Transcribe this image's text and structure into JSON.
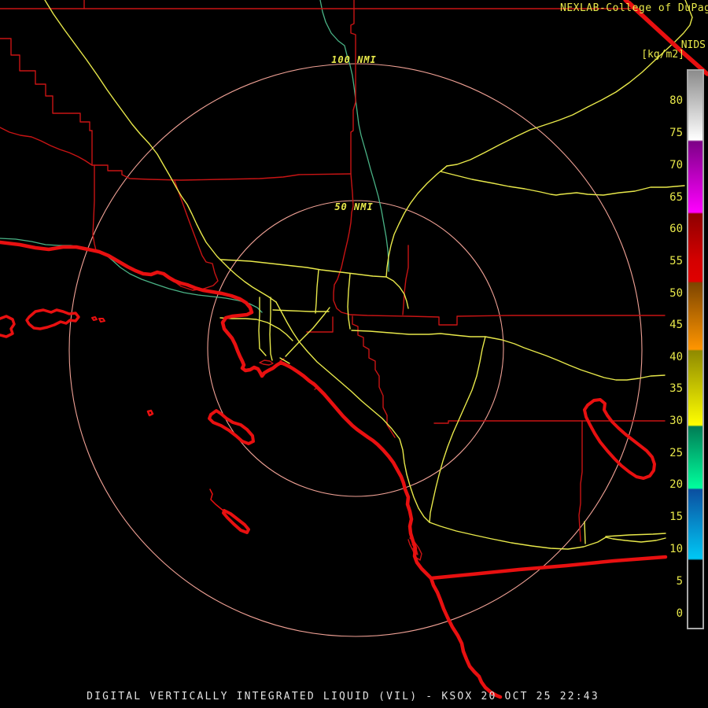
{
  "header": {
    "brand": "NEXLAB-College of DuPage",
    "flag_icon": "cod-flag-icon"
  },
  "colorbar": {
    "title": "NIDS",
    "unit": "[kg/m2]",
    "ticks": [
      "80",
      "75",
      "70",
      "65",
      "60",
      "55",
      "50",
      "45",
      "40",
      "35",
      "30",
      "25",
      "20",
      "15",
      "10",
      "5",
      "0"
    ],
    "segments": [
      {
        "from": 85,
        "to": 73,
        "colors": [
          "#8c8c8c",
          "#ffffff"
        ]
      },
      {
        "from": 73,
        "to": 62.5,
        "colors": [
          "#7d0087",
          "#ff00ff"
        ]
      },
      {
        "from": 62.5,
        "to": 51.5,
        "colors": [
          "#8f0000",
          "#e00000"
        ]
      },
      {
        "from": 51.5,
        "to": 40.5,
        "colors": [
          "#7d4500",
          "#ff9500"
        ]
      },
      {
        "from": 40.5,
        "to": 29.5,
        "colors": [
          "#8f8a00",
          "#ffff00"
        ]
      },
      {
        "from": 29.5,
        "to": 18.5,
        "colors": [
          "#007d55",
          "#00ff9d"
        ]
      },
      {
        "from": 18.5,
        "to": 7,
        "colors": [
          "#0b4fa0",
          "#00c8f5"
        ]
      },
      {
        "from": 7,
        "to": -3,
        "colors": [
          "#000000",
          "#000000"
        ]
      }
    ]
  },
  "rings": {
    "outer_label": "100 NMI",
    "inner_label": "50 NMI"
  },
  "caption": "DIGITAL VERTICALLY INTEGRATED LIQUID (VIL) - KSOX 20 OCT 25 22:43",
  "colors": {
    "background": "#000000",
    "label_yellow": "#e8e84a",
    "boundary_red": "#c81414",
    "coastline_red": "#e81010",
    "highway_yellow": "#e8e84a",
    "river_teal": "#4ab386",
    "range_ring_pink": "#f0a195",
    "caption_white": "#e2e2e2"
  }
}
